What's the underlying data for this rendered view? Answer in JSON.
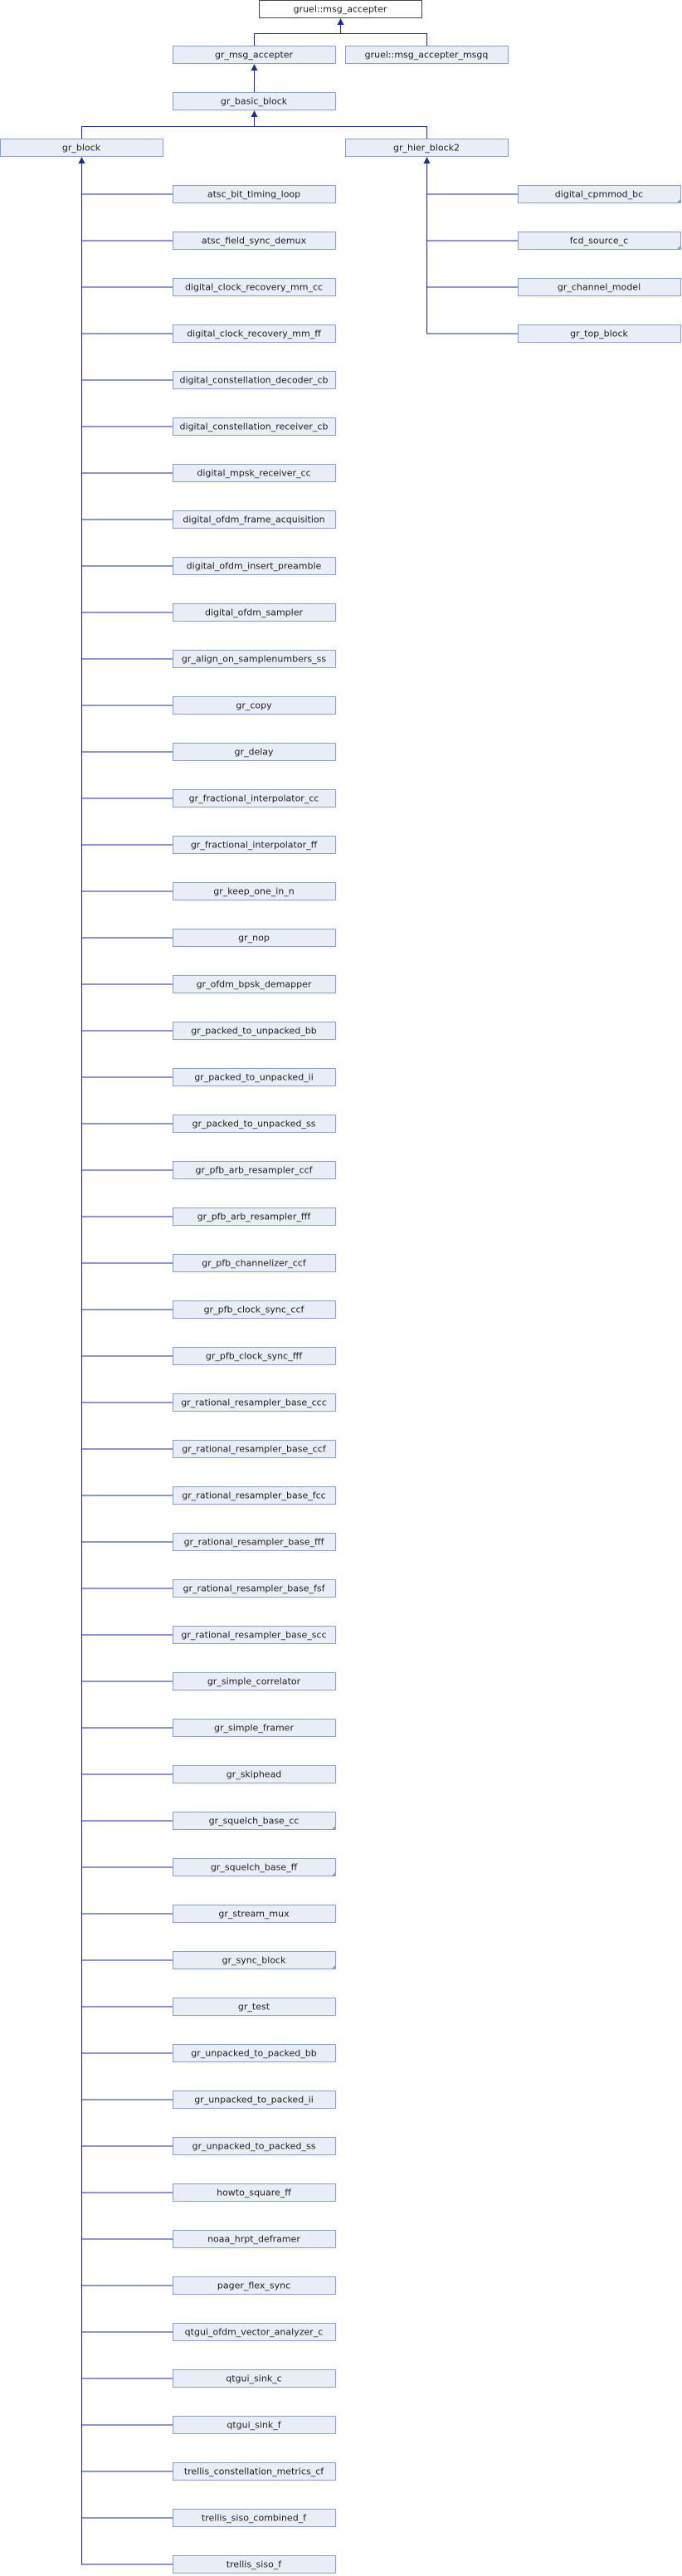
{
  "diagram": {
    "root": "gruel::msg_accepter",
    "level1": [
      "gr_msg_accepter",
      "gruel::msg_accepter_msgq"
    ],
    "basic": "gr_basic_block",
    "block": "gr_block",
    "hier": "gr_hier_block2",
    "hier_children": [
      {
        "label": "digital_cpmmod_bc",
        "more": true
      },
      {
        "label": "fcd_source_c",
        "more": true
      },
      {
        "label": "gr_channel_model",
        "more": false
      },
      {
        "label": "gr_top_block",
        "more": false
      }
    ],
    "block_children": [
      {
        "label": "atsc_bit_timing_loop",
        "more": false
      },
      {
        "label": "atsc_field_sync_demux",
        "more": false
      },
      {
        "label": "digital_clock_recovery_mm_cc",
        "more": false
      },
      {
        "label": "digital_clock_recovery_mm_ff",
        "more": false
      },
      {
        "label": "digital_constellation_decoder_cb",
        "more": false
      },
      {
        "label": "digital_constellation_receiver_cb",
        "more": false
      },
      {
        "label": "digital_mpsk_receiver_cc",
        "more": false
      },
      {
        "label": "digital_ofdm_frame_acquisition",
        "more": false
      },
      {
        "label": "digital_ofdm_insert_preamble",
        "more": false
      },
      {
        "label": "digital_ofdm_sampler",
        "more": false
      },
      {
        "label": "gr_align_on_samplenumbers_ss",
        "more": false
      },
      {
        "label": "gr_copy",
        "more": false
      },
      {
        "label": "gr_delay",
        "more": false
      },
      {
        "label": "gr_fractional_interpolator_cc",
        "more": false
      },
      {
        "label": "gr_fractional_interpolator_ff",
        "more": false
      },
      {
        "label": "gr_keep_one_in_n",
        "more": false
      },
      {
        "label": "gr_nop",
        "more": false
      },
      {
        "label": "gr_ofdm_bpsk_demapper",
        "more": false
      },
      {
        "label": "gr_packed_to_unpacked_bb",
        "more": false
      },
      {
        "label": "gr_packed_to_unpacked_ii",
        "more": false
      },
      {
        "label": "gr_packed_to_unpacked_ss",
        "more": false
      },
      {
        "label": "gr_pfb_arb_resampler_ccf",
        "more": false
      },
      {
        "label": "gr_pfb_arb_resampler_fff",
        "more": false
      },
      {
        "label": "gr_pfb_channelizer_ccf",
        "more": false
      },
      {
        "label": "gr_pfb_clock_sync_ccf",
        "more": false
      },
      {
        "label": "gr_pfb_clock_sync_fff",
        "more": false
      },
      {
        "label": "gr_rational_resampler_base_ccc",
        "more": false
      },
      {
        "label": "gr_rational_resampler_base_ccf",
        "more": false
      },
      {
        "label": "gr_rational_resampler_base_fcc",
        "more": false
      },
      {
        "label": "gr_rational_resampler_base_fff",
        "more": false
      },
      {
        "label": "gr_rational_resampler_base_fsf",
        "more": false
      },
      {
        "label": "gr_rational_resampler_base_scc",
        "more": false
      },
      {
        "label": "gr_simple_correlator",
        "more": false
      },
      {
        "label": "gr_simple_framer",
        "more": false
      },
      {
        "label": "gr_skiphead",
        "more": false
      },
      {
        "label": "gr_squelch_base_cc",
        "more": true
      },
      {
        "label": "gr_squelch_base_ff",
        "more": true
      },
      {
        "label": "gr_stream_mux",
        "more": false
      },
      {
        "label": "gr_sync_block",
        "more": true
      },
      {
        "label": "gr_test",
        "more": false
      },
      {
        "label": "gr_unpacked_to_packed_bb",
        "more": false
      },
      {
        "label": "gr_unpacked_to_packed_ii",
        "more": false
      },
      {
        "label": "gr_unpacked_to_packed_ss",
        "more": false
      },
      {
        "label": "howto_square_ff",
        "more": false
      },
      {
        "label": "noaa_hrpt_deframer",
        "more": false
      },
      {
        "label": "pager_flex_sync",
        "more": false
      },
      {
        "label": "qtgui_ofdm_vector_analyzer_c",
        "more": false
      },
      {
        "label": "qtgui_sink_c",
        "more": false
      },
      {
        "label": "qtgui_sink_f",
        "more": false
      },
      {
        "label": "trellis_constellation_metrics_cf",
        "more": false
      },
      {
        "label": "trellis_siso_combined_f",
        "more": false
      },
      {
        "label": "trellis_siso_f",
        "more": false
      }
    ]
  }
}
